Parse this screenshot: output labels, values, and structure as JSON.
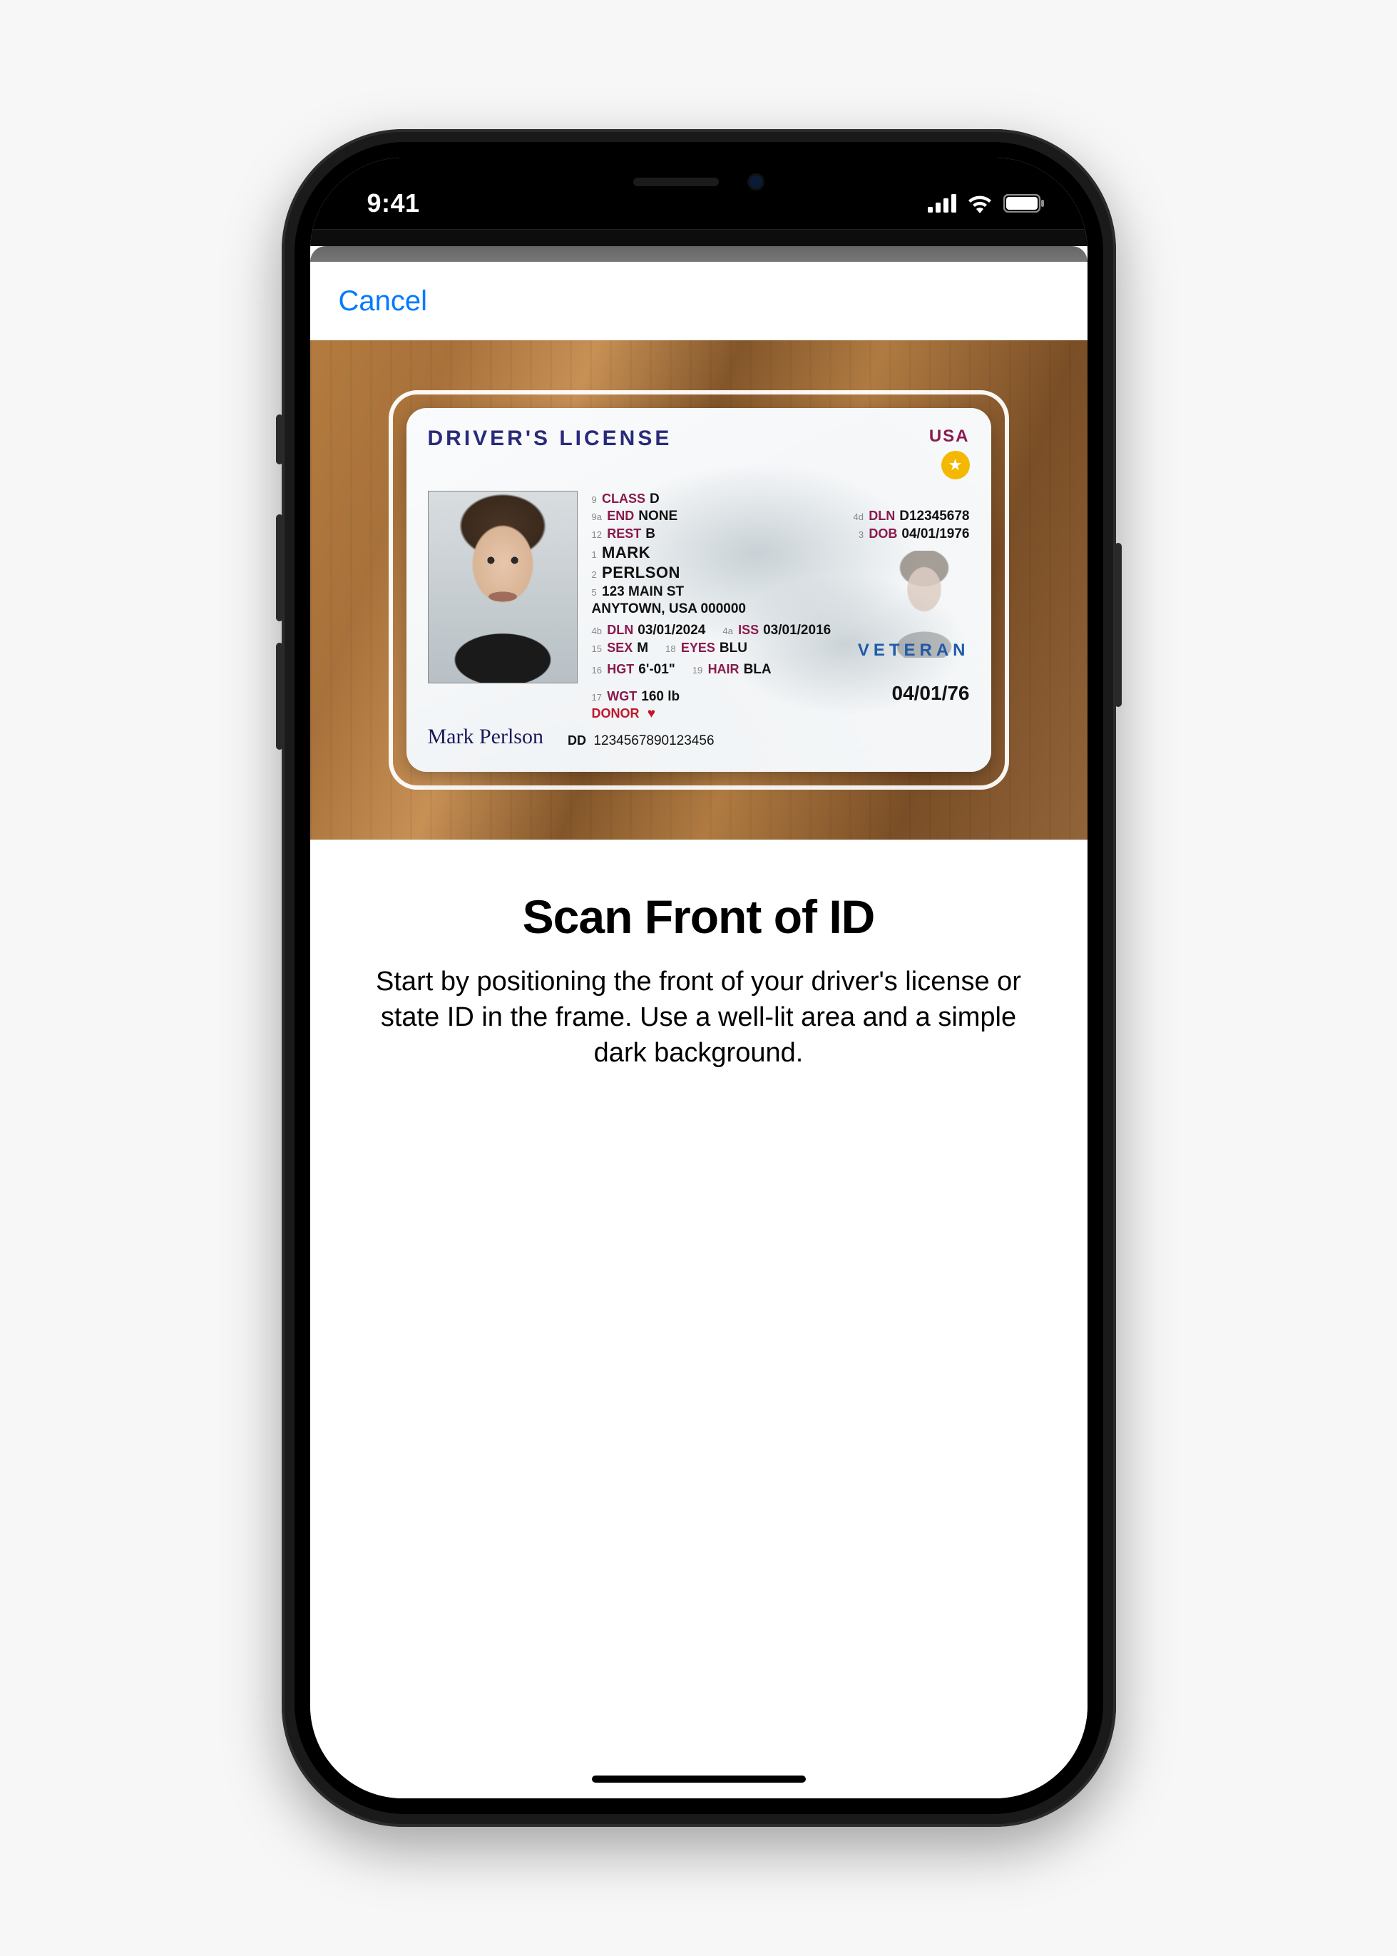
{
  "status": {
    "time": "9:41"
  },
  "nav": {
    "cancel": "Cancel"
  },
  "instructions": {
    "title": "Scan Front of ID",
    "body": "Start by positioning the front of your driver's license or state ID in the frame. Use a well-lit area and a simple dark background."
  },
  "id_card": {
    "title": "DRIVER'S LICENSE",
    "country": "USA",
    "fields": {
      "class": {
        "n": "9",
        "k": "CLASS",
        "v": "D"
      },
      "end": {
        "n": "9a",
        "k": "END",
        "v": "NONE"
      },
      "rest": {
        "n": "12",
        "k": "REST",
        "v": "B"
      },
      "dln": {
        "n": "4d",
        "k": "DLN",
        "v": "D12345678"
      },
      "dob": {
        "n": "3",
        "k": "DOB",
        "v": "04/01/1976"
      },
      "first": {
        "n": "1",
        "k": "",
        "v": "MARK"
      },
      "last": {
        "n": "2",
        "k": "",
        "v": "PERLSON"
      },
      "addr1": {
        "n": "5",
        "k": "",
        "v": "123 MAIN ST"
      },
      "addr2": {
        "k": "",
        "v": "ANYTOWN, USA 000000"
      },
      "dln2": {
        "n": "4b",
        "k": "DLN",
        "v": "03/01/2024"
      },
      "iss": {
        "n": "4a",
        "k": "ISS",
        "v": "03/01/2016"
      },
      "sex": {
        "n": "15",
        "k": "SEX",
        "v": "M"
      },
      "eyes": {
        "n": "18",
        "k": "EYES",
        "v": "BLU"
      },
      "hgt": {
        "n": "16",
        "k": "HGT",
        "v": "6'-01\""
      },
      "hair": {
        "n": "19",
        "k": "HAIR",
        "v": "BLA"
      },
      "wgt": {
        "n": "17",
        "k": "WGT",
        "v": "160 lb"
      }
    },
    "veteran": "VETERAN",
    "donor_label": "DONOR",
    "dob_big": "04/01/76",
    "dd_label": "DD",
    "dd": "1234567890123456",
    "signature": "Mark Perlson"
  }
}
